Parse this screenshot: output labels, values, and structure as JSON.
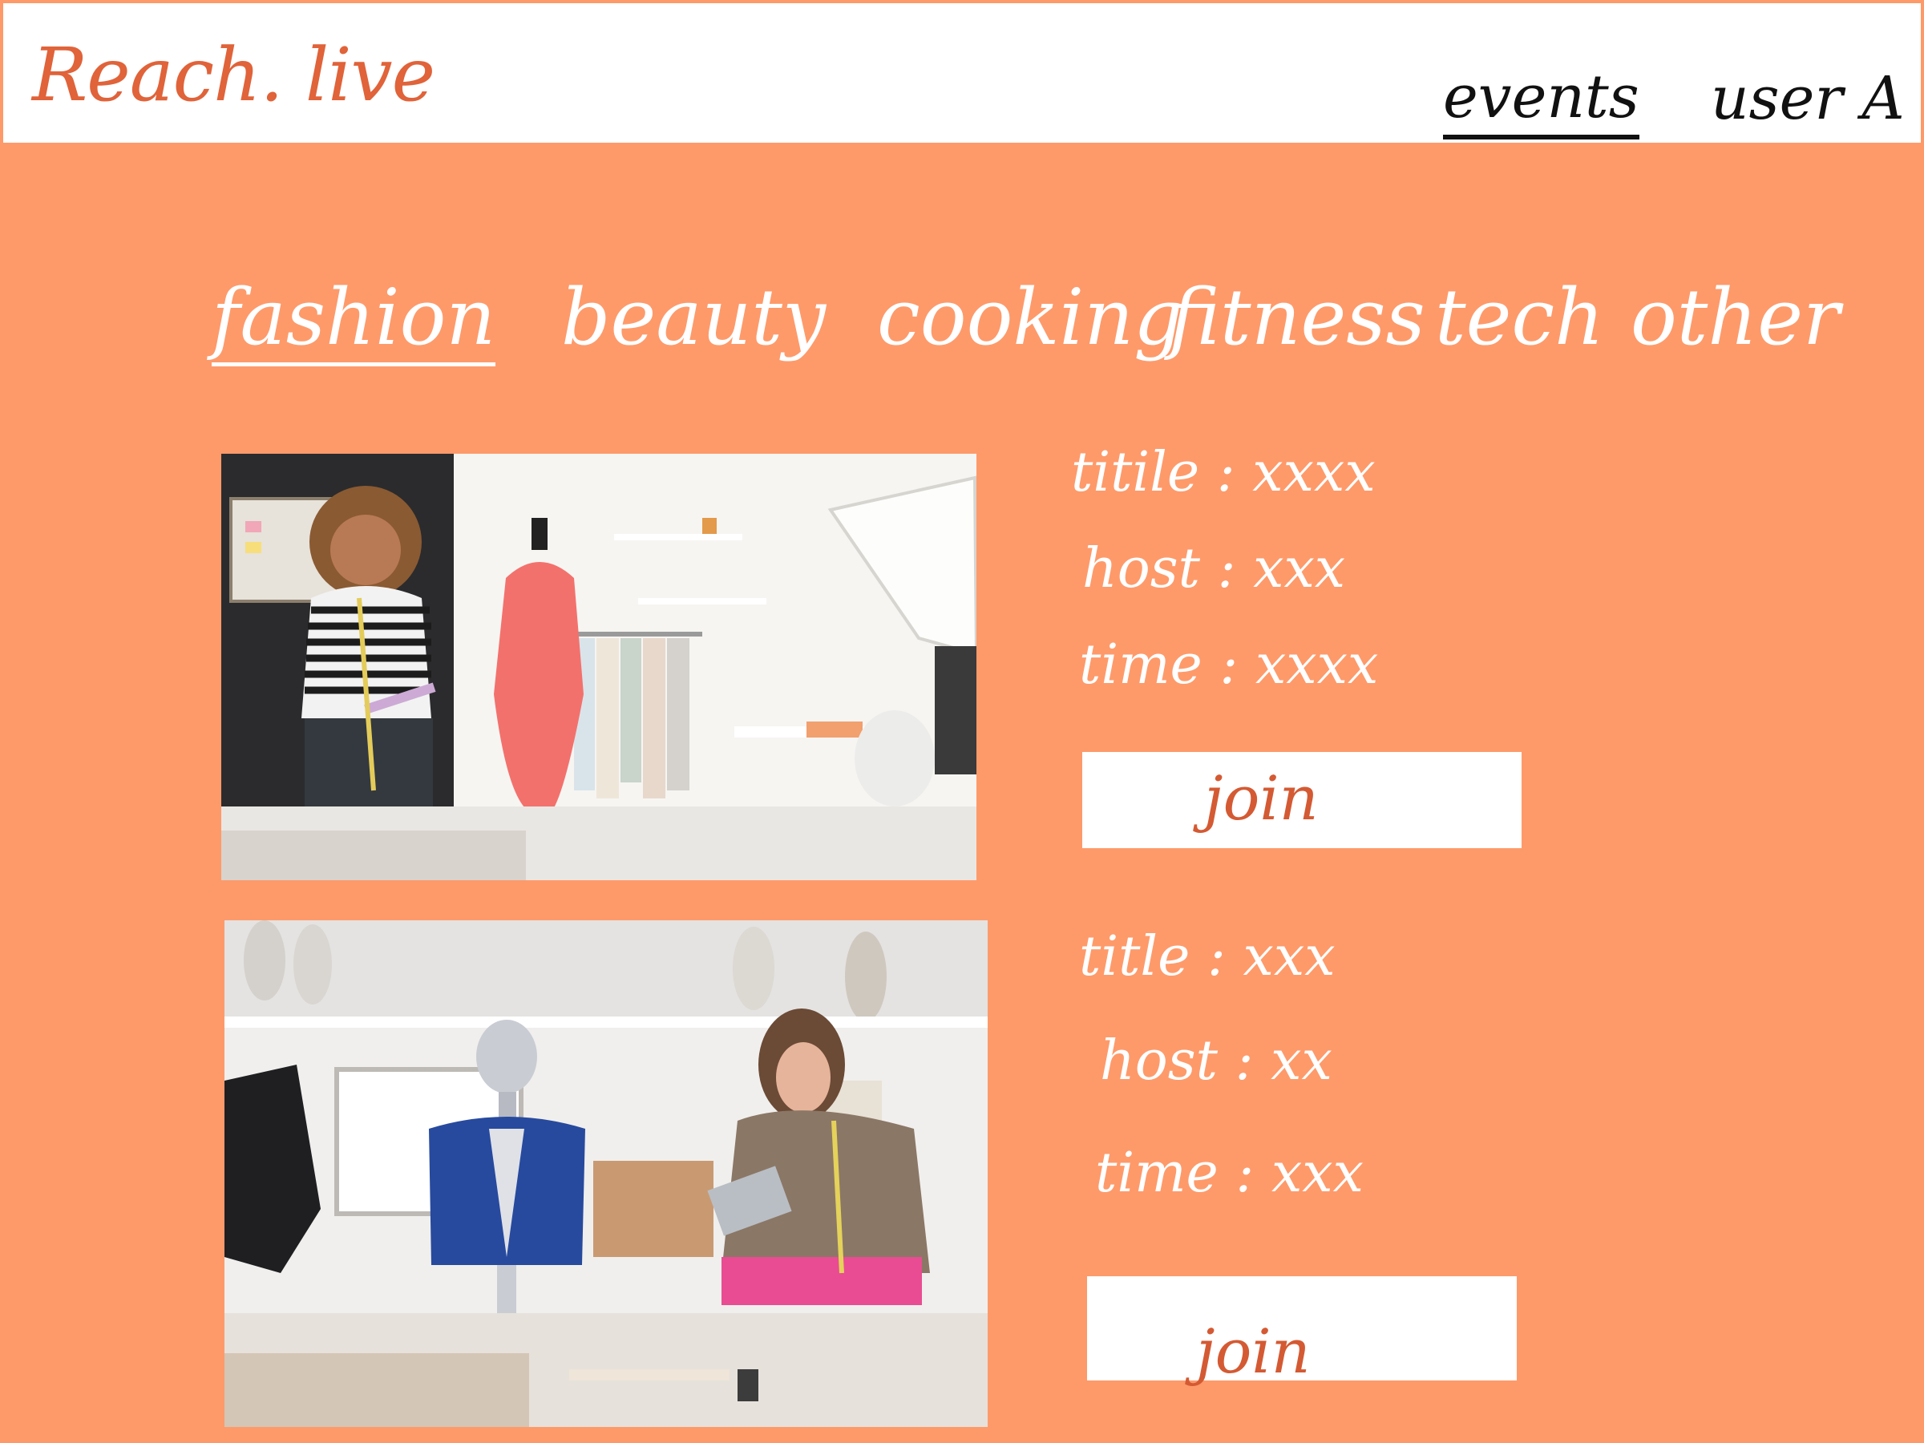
{
  "header": {
    "brand": "Reach. live",
    "nav_events": "events",
    "nav_user": "user A"
  },
  "categories": {
    "items": [
      "fashion",
      "beauty",
      "cooking",
      "fitness",
      "tech",
      "other"
    ],
    "active": "fashion"
  },
  "events": [
    {
      "title_line": "titile : xxxx",
      "host_line": "host :  xxx",
      "time_line": "time : xxxx",
      "join_label": "join",
      "photo_icon": "designer-with-dress-form-photo"
    },
    {
      "title_line": "title : xxx",
      "host_line": "host : xx",
      "time_line": "time : xxx",
      "join_label": "join",
      "photo_icon": "designer-with-mannequin-photo"
    }
  ],
  "colors": {
    "page_background": "#FE9A6A",
    "brand": "#E0633A",
    "join_text": "#D45A33"
  }
}
